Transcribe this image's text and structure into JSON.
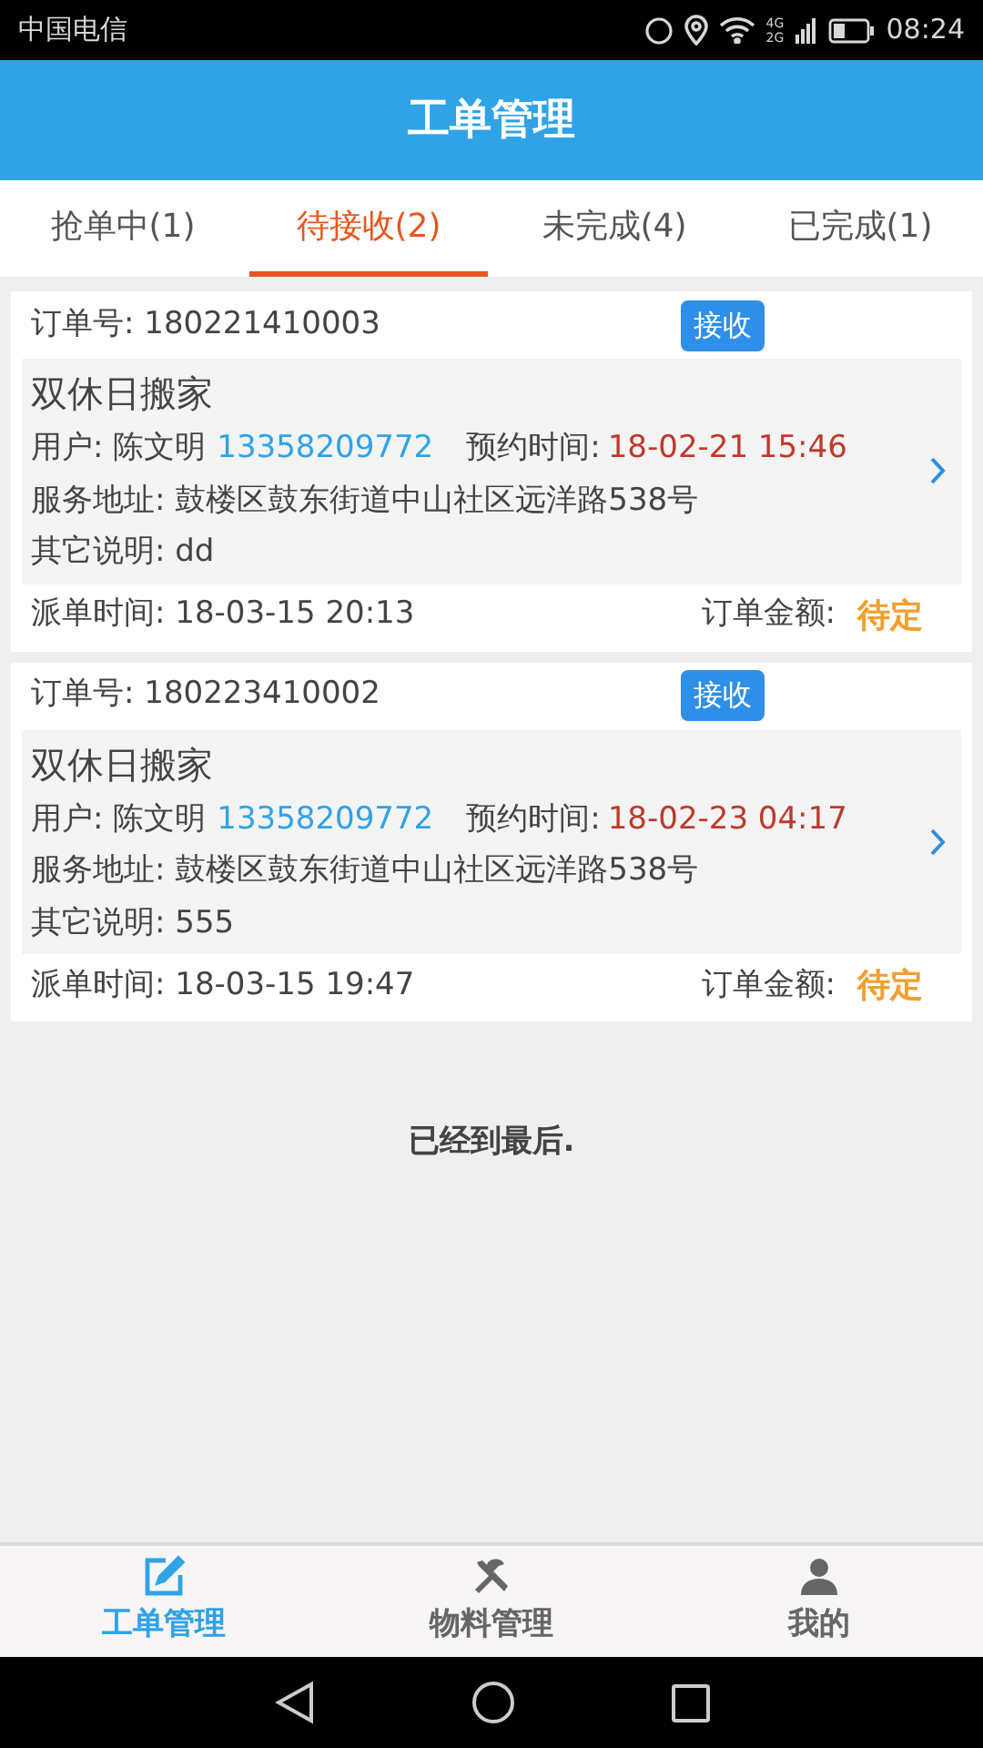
{
  "status_bar": {
    "carrier": "中国电信",
    "network": "4G 2G",
    "time": "08:24"
  },
  "header": {
    "title": "工单管理"
  },
  "tabs": [
    {
      "label": "抢单中(1)",
      "selected": false
    },
    {
      "label": "待接收(2)",
      "selected": true
    },
    {
      "label": "未完成(4)",
      "selected": false
    },
    {
      "label": "已完成(1)",
      "selected": false
    }
  ],
  "orders": [
    {
      "order_no": "订单号: 180221410003",
      "accept_button": "接收",
      "service": "双休日搬家",
      "user": "用户: 陈文明",
      "phone": "13358209772",
      "appointment_label": "预约时间:",
      "appointment_time": "18-02-21 15:46",
      "address": "服务地址: 鼓楼区鼓东街道中山社区远洋路538号",
      "note": "其它说明: dd",
      "dispatch_time": "派单时间: 18-03-15 20:13",
      "amount_label": "订单金额:",
      "amount": "待定"
    },
    {
      "order_no": "订单号: 180223410002",
      "accept_button": "接收",
      "service": "双休日搬家",
      "user": "用户: 陈文明",
      "phone": "13358209772",
      "appointment_label": "预约时间:",
      "appointment_time": "18-02-23 04:17",
      "address": "服务地址: 鼓楼区鼓东街道中山社区远洋路538号",
      "note": "其它说明: 555",
      "dispatch_time": "派单时间: 18-03-15 19:47",
      "amount_label": "订单金额:",
      "amount": "待定"
    }
  ],
  "end_message": "已经到最后.",
  "bottom_nav": [
    {
      "label": "工单管理",
      "kind": "edit",
      "selected": true
    },
    {
      "label": "物料管理",
      "kind": "tools",
      "selected": false
    },
    {
      "label": "我的",
      "kind": "user",
      "selected": false
    }
  ]
}
